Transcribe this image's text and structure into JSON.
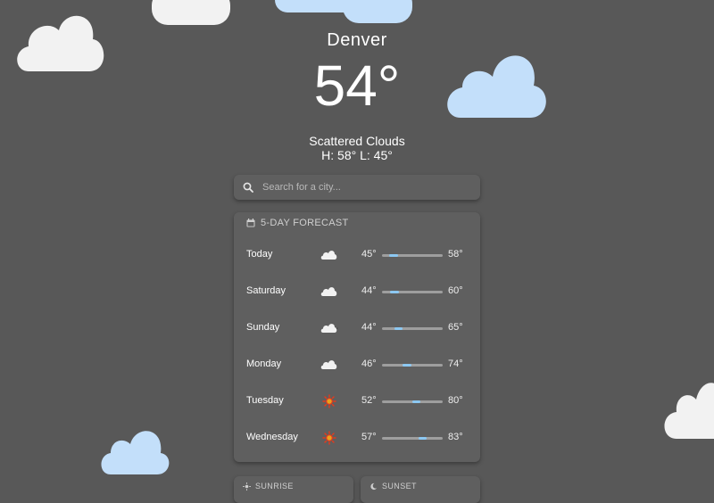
{
  "location": {
    "city": "Denver"
  },
  "current": {
    "temperature": "54°",
    "condition": "Scattered Clouds",
    "high_low": "H: 58°  L: 45°"
  },
  "search": {
    "placeholder": "Search for a city..."
  },
  "forecast": {
    "title": "5-DAY FORECAST",
    "days": [
      {
        "day": "Today",
        "icon": "cloud-icon",
        "low": "45°",
        "high": "58°",
        "range": [
          45,
          58
        ]
      },
      {
        "day": "Saturday",
        "icon": "cloud-icon",
        "low": "44°",
        "high": "60°",
        "range": [
          44,
          60
        ]
      },
      {
        "day": "Sunday",
        "icon": "partly-cloudy-night-icon",
        "low": "44°",
        "high": "65°",
        "range": [
          44,
          65
        ]
      },
      {
        "day": "Monday",
        "icon": "cloud-icon",
        "low": "46°",
        "high": "74°",
        "range": [
          46,
          74
        ]
      },
      {
        "day": "Tuesday",
        "icon": "sun-icon",
        "low": "52°",
        "high": "80°",
        "range": [
          52,
          80
        ]
      },
      {
        "day": "Wednesday",
        "icon": "sun-icon",
        "low": "57°",
        "high": "83°",
        "range": [
          57,
          83
        ]
      }
    ]
  },
  "tiles": {
    "sunrise_label": "SUNRISE",
    "sunset_label": "SUNSET"
  },
  "colors": {
    "background": "#585858",
    "card": "#5f5f5f",
    "cloud_white": "#f2f2f2",
    "cloud_blue": "#c3dffa",
    "range_fill": "#8cc8f2",
    "sun": "#e8391c"
  }
}
